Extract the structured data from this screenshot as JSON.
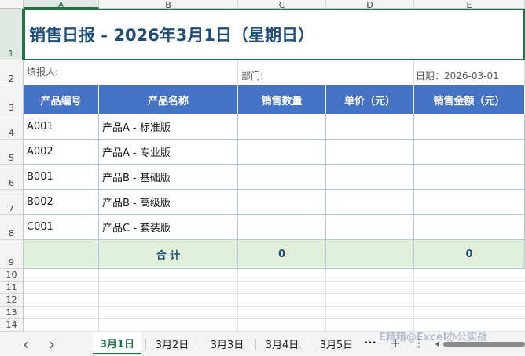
{
  "columns": [
    "A",
    "B",
    "C",
    "D",
    "E"
  ],
  "rows": [
    "1",
    "2",
    "3",
    "4",
    "5",
    "6",
    "7",
    "8",
    "9",
    "10",
    "11",
    "12",
    "13",
    "14"
  ],
  "title": "销售日报 - 2026年3月1日（星期日）",
  "info": {
    "reporter": "填报人:",
    "department": "部门:",
    "date": "日期：2026-03-01"
  },
  "table": {
    "headers": [
      "产品编号",
      "产品名称",
      "销售数量",
      "单价（元）",
      "销售金额（元）"
    ],
    "rows": [
      {
        "code": "A001",
        "name": "产品A - 标准版"
      },
      {
        "code": "A002",
        "name": "产品A - 专业版"
      },
      {
        "code": "B001",
        "name": "产品B - 基础版"
      },
      {
        "code": "B002",
        "name": "产品B - 高级版"
      },
      {
        "code": "C001",
        "name": "产品C - 套装版"
      }
    ],
    "total": {
      "label": "合 计",
      "qty": "0",
      "amount": "0"
    }
  },
  "tabs": [
    "3月1日",
    "3月2日",
    "3月3日",
    "3月4日",
    "3月5日"
  ],
  "tab_more": "•••",
  "tab_add": "+",
  "tab_menu": "⋮",
  "nav_prev": "‹",
  "nav_next": "›",
  "watermark": "E精精@Excel办公实战",
  "colors": {
    "header_blue": "#4472c4",
    "title_blue": "#1f4e79",
    "total_green": "#e2efda",
    "excel_green": "#217346"
  }
}
